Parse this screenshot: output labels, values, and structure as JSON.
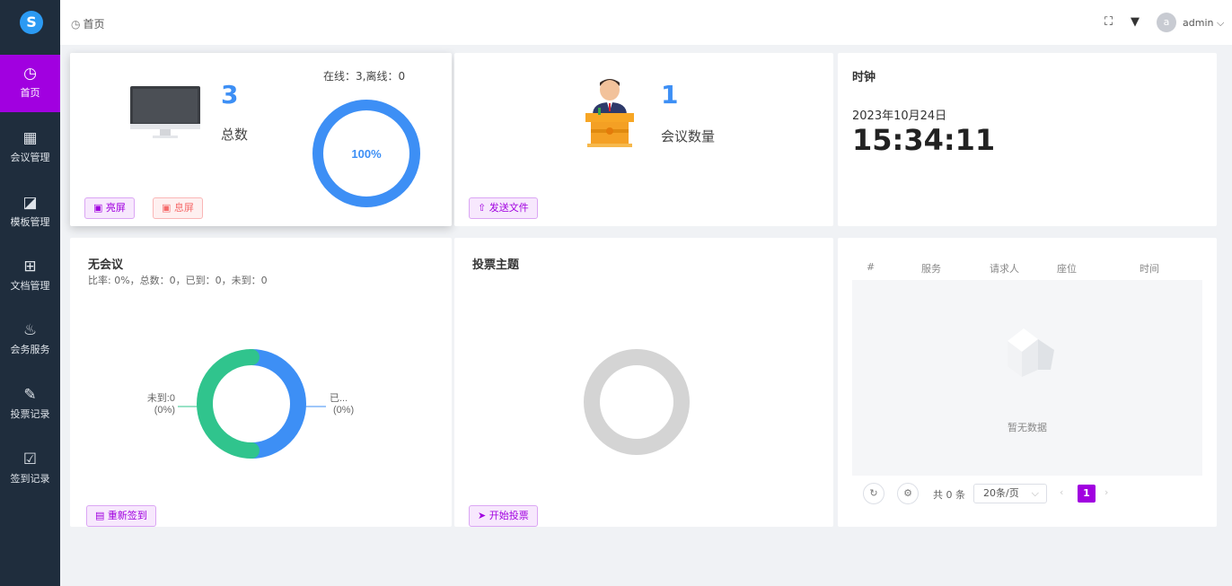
{
  "colors": {
    "accent": "#a100e0",
    "sidebar_bg": "#1f2d3d",
    "blue": "#3d8ff5",
    "green": "#30c48d",
    "grey_ring": "#d4d4d4"
  },
  "sidebar": {
    "logo": "S",
    "items": [
      {
        "icon": "pie-chart-icon",
        "glyph": "◷",
        "label": "首页",
        "active": true
      },
      {
        "icon": "calendar-icon",
        "glyph": "▦",
        "label": "会议管理"
      },
      {
        "icon": "image-icon",
        "glyph": "◪",
        "label": "模板管理"
      },
      {
        "icon": "grid-icon",
        "glyph": "⊞",
        "label": "文档管理"
      },
      {
        "icon": "cup-icon",
        "glyph": "♨",
        "label": "会务服务"
      },
      {
        "icon": "pen-icon",
        "glyph": "✎",
        "label": "投票记录"
      },
      {
        "icon": "clipboard-check-icon",
        "glyph": "☑",
        "label": "签到记录"
      }
    ]
  },
  "header": {
    "breadcrumb": "首页",
    "user_initial": "a",
    "user": "admin"
  },
  "devices": {
    "total": "3",
    "total_label": "总数",
    "status": "在线：3,离线：0",
    "percent": "100%",
    "percent_value": 100,
    "btn_on": "亮屏",
    "btn_off": "息屏"
  },
  "meetings": {
    "count": "1",
    "label": "会议数量",
    "btn_send": "发送文件"
  },
  "clock": {
    "title": "时钟",
    "date": "2023年10月24日",
    "time": "15:34:11"
  },
  "signin": {
    "title": "无会议",
    "stats": "比率: 0%，总数：0，已到：0，未到：0",
    "label_left": "未到:0",
    "label_left_pct": "(0%)",
    "label_right": "已...",
    "label_right_pct": "(0%)",
    "btn": "重新签到"
  },
  "vote": {
    "title": "投票主题",
    "btn": "开始投票"
  },
  "service_table": {
    "headers": [
      "#",
      "服务",
      "请求人",
      "座位",
      "时间"
    ],
    "empty": "暂无数据",
    "total": "共 0 条",
    "page_size": "20条/页",
    "page": "1"
  }
}
